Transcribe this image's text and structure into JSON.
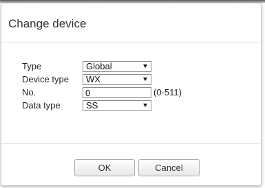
{
  "dialog": {
    "title": "Change device"
  },
  "form": {
    "type": {
      "label": "Type",
      "selected": "Global",
      "arrow_icon": "chevron-down-icon"
    },
    "device_type": {
      "label": "Device type",
      "selected": "WX",
      "arrow_icon": "chevron-down-icon"
    },
    "number": {
      "label": "No.",
      "value": "0",
      "range_hint": "(0-511)"
    },
    "data_type": {
      "label": "Data type",
      "selected": "SS",
      "arrow_icon": "chevron-down-icon"
    }
  },
  "buttons": {
    "ok_label": "OK",
    "cancel_label": "Cancel"
  },
  "colors": {
    "border": "#8a8a8a",
    "button_border": "#adadad",
    "text": "#333333"
  }
}
